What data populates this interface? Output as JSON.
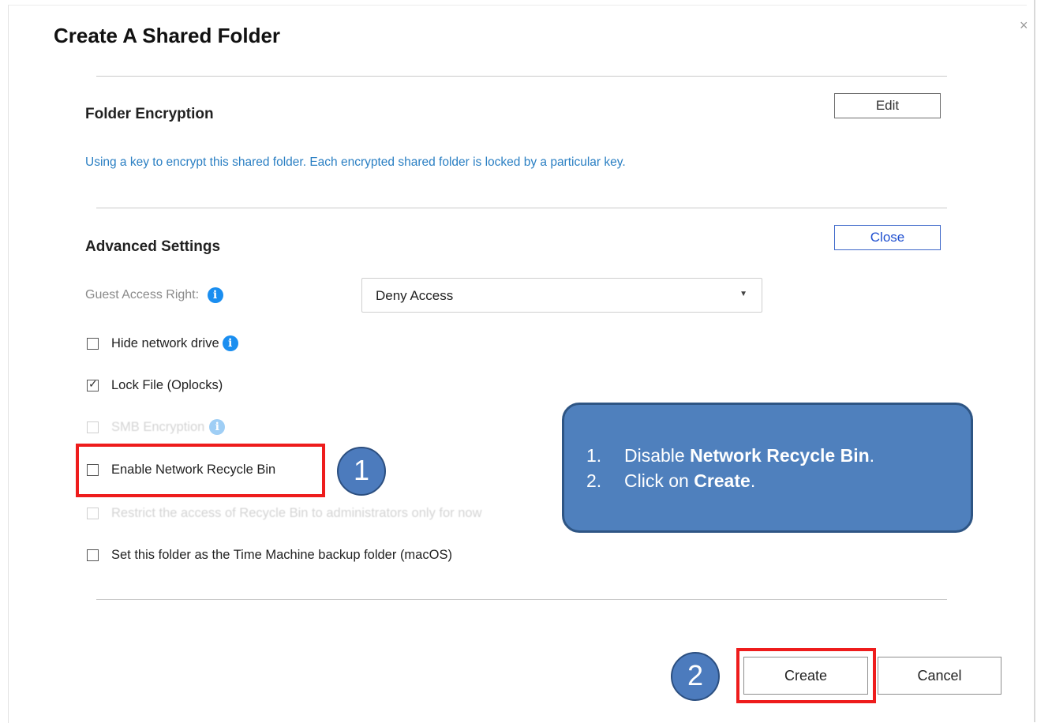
{
  "dialog": {
    "title": "Create A Shared Folder",
    "close_glyph": "×"
  },
  "encryption": {
    "title": "Folder Encryption",
    "edit_label": "Edit",
    "description": "Using a key to encrypt this shared folder. Each encrypted shared folder is locked by a particular key."
  },
  "advanced": {
    "title": "Advanced Settings",
    "close_label": "Close",
    "guest_access_label": "Guest Access Right:",
    "guest_access_value": "Deny Access",
    "info_glyph": "i",
    "options": [
      {
        "label": "Hide network drive",
        "checked": false,
        "disabled": false
      },
      {
        "label": "Lock File (Oplocks)",
        "checked": true,
        "disabled": false
      },
      {
        "label": "SMB Encryption",
        "checked": false,
        "disabled": true
      },
      {
        "label": "Enable Network Recycle Bin",
        "checked": false,
        "disabled": false
      },
      {
        "label": "Restrict the access of Recycle Bin to administrators only for now",
        "checked": false,
        "disabled": true
      },
      {
        "label": "Set this folder as the Time Machine backup folder (macOS)",
        "checked": false,
        "disabled": false
      }
    ]
  },
  "footer": {
    "create_label": "Create",
    "cancel_label": "Cancel"
  },
  "annotations": {
    "step1": "1",
    "step2": "2",
    "instructions": [
      {
        "num": "1.",
        "before": "Disable ",
        "bold": "Network Recycle Bin",
        "after": "."
      },
      {
        "num": "2.",
        "before": "Click on ",
        "bold": "Create",
        "after": "."
      }
    ],
    "highlight_color": "#ee1c1c",
    "callout_color": "#4f80bd"
  }
}
